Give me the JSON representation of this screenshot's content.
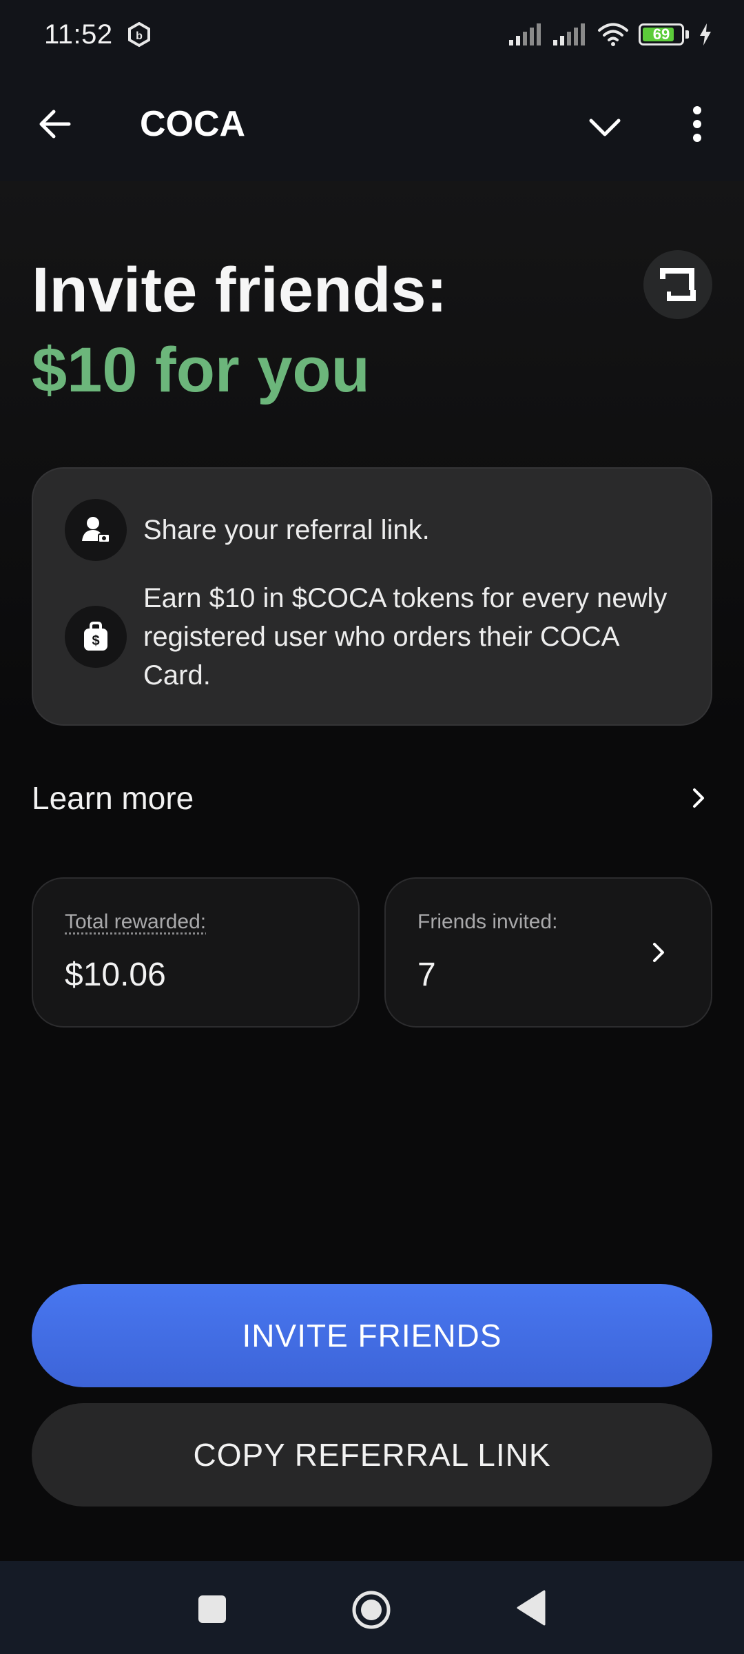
{
  "status_bar": {
    "time": "11:52",
    "battery_level": "69",
    "icons": [
      "app-notification-icon",
      "signal-icon",
      "signal-icon",
      "wifi-icon",
      "battery-icon",
      "charging-icon"
    ]
  },
  "app_bar": {
    "title": "COCA",
    "icons": [
      "back-arrow-icon",
      "chevron-down-icon",
      "more-vertical-icon"
    ]
  },
  "headline": {
    "line1": "Invite friends:",
    "line2": "$10 for you",
    "accent_color": "#6cb67b"
  },
  "info_card": {
    "items": [
      {
        "icon": "user-ticket-icon",
        "text": "Share your referral link."
      },
      {
        "icon": "money-bag-icon",
        "text": "Earn $10 in $COCA tokens for every newly registered user who orders their COCA Card."
      }
    ]
  },
  "learn_more": {
    "label": "Learn more"
  },
  "stats": {
    "total_rewarded_label": "Total rewarded:",
    "total_rewarded_value": "$10.06",
    "friends_invited_label": "Friends invited:",
    "friends_invited_value": "7"
  },
  "buttons": {
    "invite_friends": "INVITE FRIENDS",
    "copy_referral_link": "COPY REFERRAL LINK",
    "primary_color": "#4270e6"
  }
}
